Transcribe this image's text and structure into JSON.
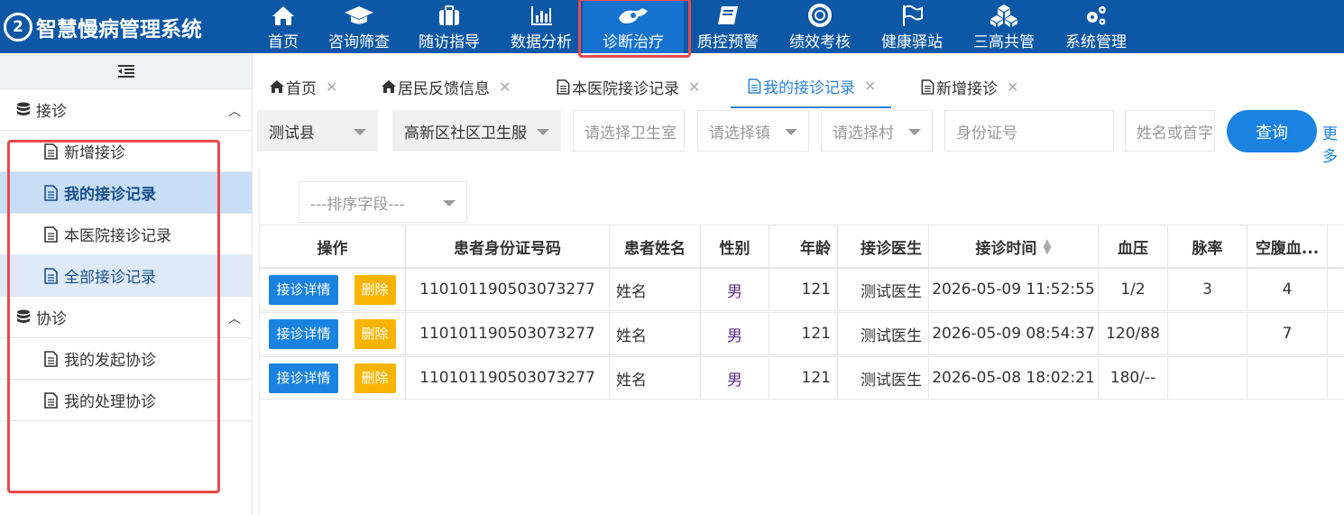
{
  "brand": {
    "logo_glyph": "2",
    "name": "智慧慢病管理系统"
  },
  "nav": [
    {
      "label": "首页",
      "icon": "home-icon"
    },
    {
      "label": "咨询筛查",
      "icon": "graduation-cap-icon"
    },
    {
      "label": "随访指导",
      "icon": "briefcase-icon"
    },
    {
      "label": "数据分析",
      "icon": "bar-chart-icon"
    },
    {
      "label": "诊断治疗",
      "icon": "hands-icon",
      "active": true
    },
    {
      "label": "质控预警",
      "icon": "book-icon"
    },
    {
      "label": "绩效考核",
      "icon": "life-ring-icon"
    },
    {
      "label": "健康驿站",
      "icon": "flag-icon"
    },
    {
      "label": "三高共管",
      "icon": "cubes-icon"
    },
    {
      "label": "系统管理",
      "icon": "gears-icon"
    }
  ],
  "sidebar": {
    "groups": [
      {
        "label": "接诊",
        "items": [
          {
            "label": "新增接诊"
          },
          {
            "label": "我的接诊记录",
            "state": "selected"
          },
          {
            "label": "本医院接诊记录"
          },
          {
            "label": "全部接诊记录",
            "state": "light"
          }
        ]
      },
      {
        "label": "协诊",
        "items": [
          {
            "label": "我的发起协诊"
          },
          {
            "label": "我的处理协诊"
          }
        ]
      }
    ]
  },
  "tabs": [
    {
      "label": "首页",
      "icon": "home-icon"
    },
    {
      "label": "居民反馈信息",
      "icon": "home-icon"
    },
    {
      "label": "本医院接诊记录",
      "icon": "document-icon"
    },
    {
      "label": "我的接诊记录",
      "icon": "document-icon",
      "active": true
    },
    {
      "label": "新增接诊",
      "icon": "document-icon"
    }
  ],
  "tab_close": "✕",
  "filters": {
    "county": "测试县",
    "center": "高新区社区卫生服",
    "clinic_placeholder": "请选择卫生室",
    "town_placeholder": "请选择镇",
    "village_placeholder": "请选择村",
    "id_placeholder": "身份证号",
    "name_placeholder": "姓名或首字",
    "query_label": "查询",
    "more_label": "更多"
  },
  "sort_placeholder": "---排序字段---",
  "table": {
    "headers": [
      "操作",
      "患者身份证号码",
      "患者姓名",
      "性别",
      "年龄",
      "接诊医生",
      "接诊时间",
      "血压",
      "脉率",
      "空腹血..."
    ],
    "detail_label": "接诊详情",
    "delete_label": "删除",
    "rows": [
      {
        "id": "110101190503073277",
        "name": "姓名",
        "sex": "男",
        "age": "121",
        "doctor": "测试医生",
        "time": "2026-05-09 11:52:55",
        "bp": "1/2",
        "pulse": "3",
        "glucose": "4"
      },
      {
        "id": "110101190503073277",
        "name": "姓名",
        "sex": "男",
        "age": "121",
        "doctor": "测试医生",
        "time": "2026-05-09 08:54:37",
        "bp": "120/88",
        "pulse": "",
        "glucose": "7"
      },
      {
        "id": "110101190503073277",
        "name": "姓名",
        "sex": "男",
        "age": "121",
        "doctor": "测试医生",
        "time": "2026-05-08 18:02:21",
        "bp": "180/--",
        "pulse": "",
        "glucose": ""
      }
    ]
  },
  "colors": {
    "primary": "#0d58a6",
    "accent": "#1a82e0",
    "warning": "#f8b400",
    "highlight": "#e84a4f"
  }
}
